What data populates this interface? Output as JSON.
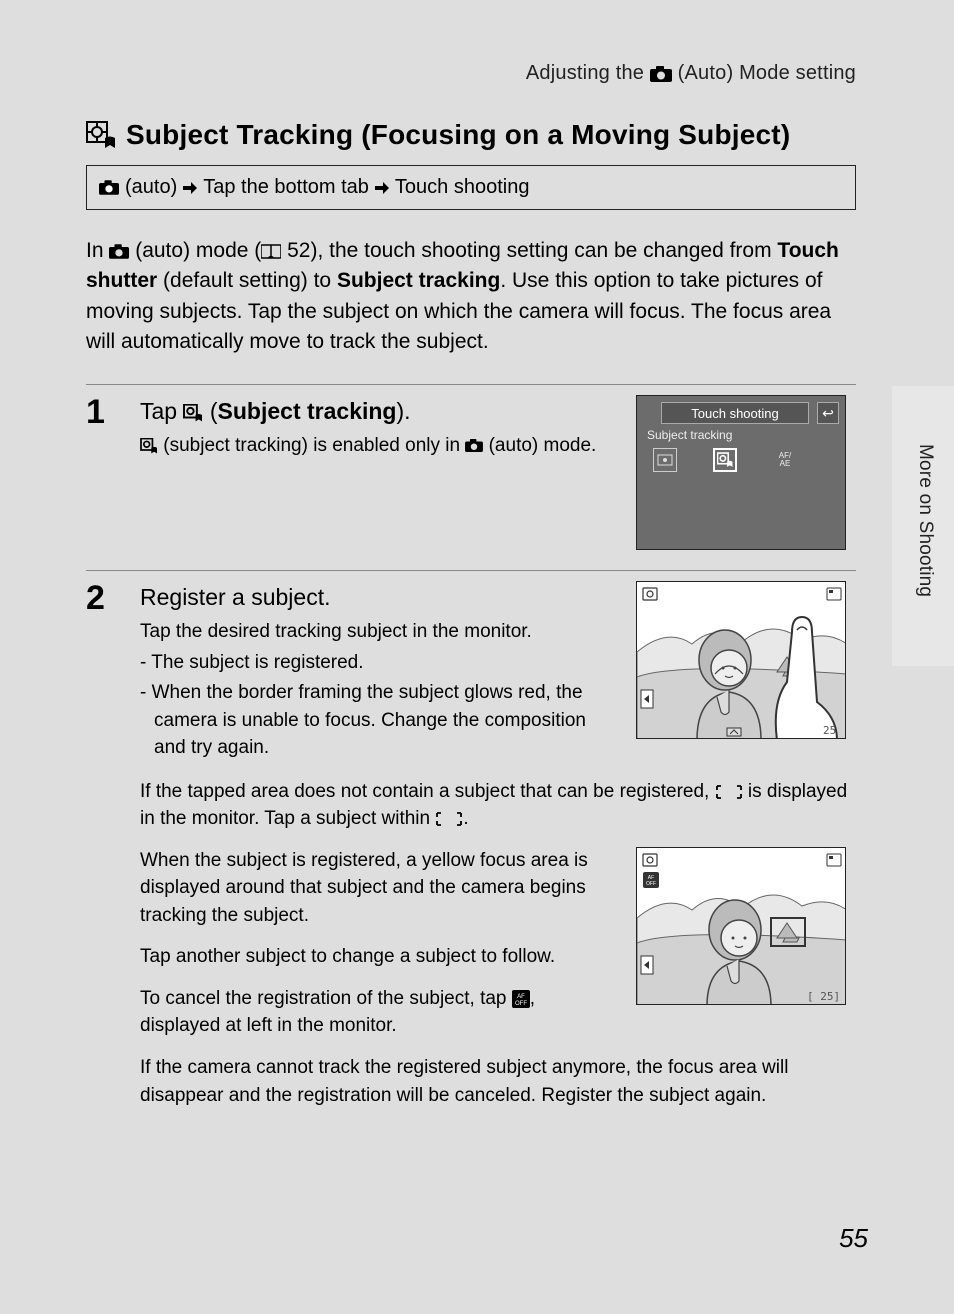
{
  "runningHead": {
    "prefix": "Adjusting the ",
    "suffix": " (Auto) Mode setting"
  },
  "sideTab": "More on Shooting",
  "title": "Subject Tracking (Focusing on a Moving Subject)",
  "nav": {
    "p1": "(auto)",
    "p2": "Tap the bottom tab",
    "p3": "Touch shooting"
  },
  "intro": {
    "t1": "In ",
    "t2": " (auto) mode (",
    "t3": " 52), the touch shooting setting can be changed from ",
    "b1": "Touch shutter",
    "t4": " (default setting) to ",
    "b2": "Subject tracking",
    "t5": ". Use this option to take pictures of moving subjects. Tap the subject on which the camera will focus. The focus area will automatically move to track the subject."
  },
  "step1": {
    "num": "1",
    "headPrefix": "Tap ",
    "headParenOpen": " (",
    "headBold": "Subject tracking",
    "headParenClose": ").",
    "note1": " (subject tracking) is enabled only in ",
    "note2": " (auto) mode.",
    "menuTitle": "Touch shooting",
    "menuSub": "Subject tracking"
  },
  "step2": {
    "num": "2",
    "head": "Register a subject.",
    "line1": "Tap the desired tracking subject in the monitor.",
    "bullets": [
      "The subject is registered.",
      "When the border framing the subject glows red, the camera is unable to focus. Change the composition and try again."
    ],
    "p2a": "If the tapped area does not contain a subject that can be registered, ",
    "p2b": " is displayed in the monitor. Tap a subject within ",
    "p2c": ".",
    "p3": "When the subject is registered, a yellow focus area is displayed around that subject and the camera begins tracking the subject.",
    "p4": "Tap another subject to change a subject to follow.",
    "p5a": "To cancel the registration of the subject, tap ",
    "p5b": ", displayed at left in the monitor.",
    "p6": "If the camera cannot track the registered subject anymore, the focus area will disappear and the registration will be canceled. Register the subject again.",
    "photoCounter": "25",
    "photoCounter2b": "25"
  },
  "pageNum": "55"
}
